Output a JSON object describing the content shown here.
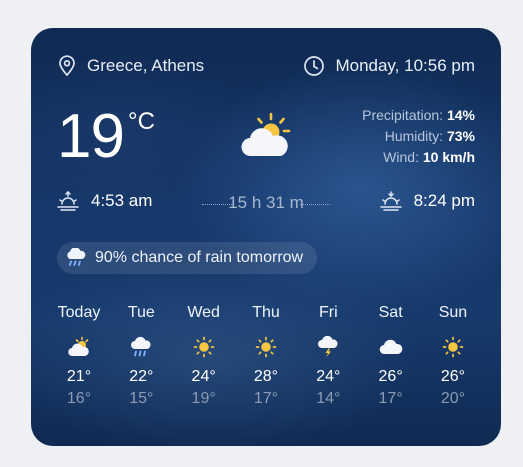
{
  "header": {
    "location": "Greece, Athens",
    "location_icon": "location-pin-icon",
    "datetime": "Monday, 10:56 pm",
    "clock_icon": "clock-icon"
  },
  "current": {
    "temperature": "19",
    "unit": "°C",
    "condition_icon": "partly-cloudy-icon",
    "precipitation_label": "Precipitation:",
    "precipitation_value": "14%",
    "humidity_label": "Humidity:",
    "humidity_value": "73%",
    "wind_label": "Wind:",
    "wind_value": "10 km/h"
  },
  "sun": {
    "sunrise": "4:53 am",
    "day_length": "15 h 31 m",
    "sunset": "8:24 pm"
  },
  "rain_notice": "90% chance of rain tomorrow",
  "forecast": [
    {
      "day": "Today",
      "icon": "partly-cloudy-icon",
      "high": "21°",
      "low": "16°"
    },
    {
      "day": "Tue",
      "icon": "rain-icon",
      "high": "22°",
      "low": "15°"
    },
    {
      "day": "Wed",
      "icon": "sun-icon",
      "high": "24°",
      "low": "19°"
    },
    {
      "day": "Thu",
      "icon": "sun-icon",
      "high": "28°",
      "low": "17°"
    },
    {
      "day": "Fri",
      "icon": "thunderstorm-icon",
      "high": "24°",
      "low": "14°"
    },
    {
      "day": "Sat",
      "icon": "cloud-icon",
      "high": "26°",
      "low": "17°"
    },
    {
      "day": "Sun",
      "icon": "sun-icon",
      "high": "26°",
      "low": "20°"
    }
  ],
  "colors": {
    "card_bg": "#16386b",
    "sun_yellow": "#f6c643",
    "rain_blue": "#7fb4ff"
  }
}
